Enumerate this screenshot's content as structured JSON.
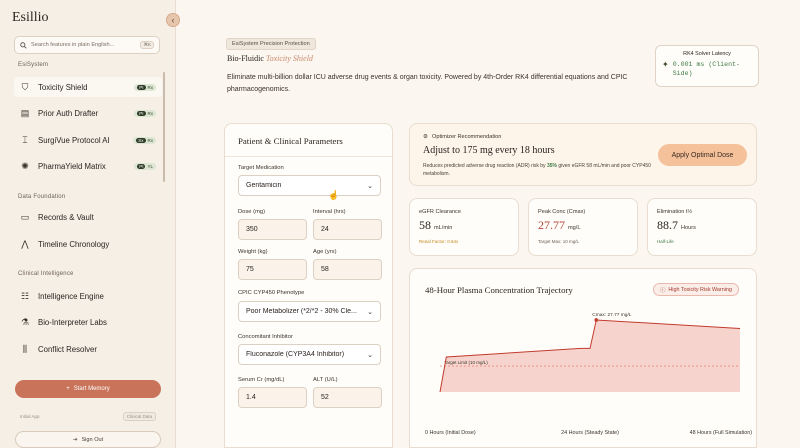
{
  "sidebar": {
    "brand": "Esillio",
    "search_placeholder": "Search features in plain English...",
    "search_shortcut": "⌘K",
    "sections": [
      {
        "label": "EsiSystem"
      },
      {
        "label": "Data Foundation"
      },
      {
        "label": "Clinical Intelligence"
      }
    ],
    "items": [
      {
        "label": "Toxicity Shield",
        "icon": "shield-icon",
        "badge_a": "PI",
        "badge_b": "Rx"
      },
      {
        "label": "Prior Auth Drafter",
        "icon": "document-icon",
        "badge_a": "PI",
        "badge_b": "Rx"
      },
      {
        "label": "SurgiVue Protocol AI",
        "icon": "scalpel-icon",
        "badge_a": "Sx",
        "badge_b": "Rx"
      },
      {
        "label": "PharmaYield Matrix",
        "icon": "gear-icon",
        "badge_a": "PI",
        "badge_b": "YL"
      },
      {
        "label": "Records & Vault",
        "icon": "folder-icon"
      },
      {
        "label": "Timeline Chronology",
        "icon": "timeline-icon"
      },
      {
        "label": "Intelligence Engine",
        "icon": "engine-icon"
      },
      {
        "label": "Bio-Interpreter Labs",
        "icon": "lab-icon"
      },
      {
        "label": "Conflict Resolver",
        "icon": "resolver-icon"
      }
    ],
    "start_memory": "Start Memory",
    "memory_left": "Initial App",
    "memory_tag_a": "Clinical",
    "memory_tag_b": "Data",
    "sign_out": "Sign Out"
  },
  "header": {
    "tag": "EsiSystem Precision Protection",
    "product_a": "Bio-Fluidic",
    "product_b": "Toxicity Shield",
    "description": "Eliminate multi-billion dollar ICU adverse drug events & organ toxicity. Powered by 4th-Order RK4 differential equations and CPIC pharmacogenomics.",
    "latency_title": "RK4 Solver Latency",
    "latency_value": "0.001 ms (Client-Side)"
  },
  "params": {
    "title": "Patient & Clinical Parameters",
    "target_medication_label": "Target Medication",
    "target_medication": "Gentamicin",
    "dose_label": "Dose (mg)",
    "dose": "350",
    "interval_label": "Interval (hrs)",
    "interval": "24",
    "weight_label": "Weight (kg)",
    "weight": "75",
    "age_label": "Age (yrs)",
    "age": "58",
    "phenotype_label": "CPIC CYP450 Phenotype",
    "phenotype": "Poor Metabolizer (*2/*2 - 30% Cle...",
    "inhibitor_label": "Concomitant Inhibitor",
    "inhibitor": "Fluconazole (CYP3A4 Inhibitor)",
    "serum_label": "Serum Cr (mg/dL)",
    "serum": "1.4",
    "alt_label": "ALT (U/L)",
    "alt": "52"
  },
  "optimizer": {
    "head": "Optimizer Recommendation",
    "title": "Adjust to 175 mg every 18 hours",
    "desc_a": "Reduces predicted adverse drug reaction (ADR) risk by",
    "desc_pct": "35%",
    "desc_b": "given eGFR 58 mL/min and poor CYP450 metabolism.",
    "apply": "Apply Optimal Dose"
  },
  "metrics": [
    {
      "label": "eGFR Clearance",
      "value": "58",
      "unit": "mL/min",
      "sub": "Renal Factor: 0.64x"
    },
    {
      "label": "Peak Conc (Cmax)",
      "value": "27.77",
      "unit": "mg/L",
      "sub": "Target Max: 10 mg/L"
    },
    {
      "label": "Elimination t½",
      "value": "88.7",
      "unit": "Hours",
      "sub": "Half-Life"
    }
  ],
  "chart": {
    "title": "48-Hour Plasma Concentration Trajectory",
    "badge": "High Toxicity Risk Warning",
    "cmax_label": "Cmax: 27.77 mg/L",
    "target_label": "Target Limit (10 mg/L)",
    "x_labels": [
      "0 Hours (Initial Dose)",
      "24 Hours (Steady State)",
      "48 Hours (Full Simulation)"
    ]
  },
  "chart_data": {
    "type": "area",
    "title": "48-Hour Plasma Concentration Trajectory",
    "x": [
      0,
      1,
      22.5,
      24,
      25,
      48
    ],
    "y": [
      0,
      13.5,
      16.8,
      16.8,
      27.77,
      24.5
    ],
    "target": 10,
    "ylim": [
      0,
      32
    ],
    "xlim": [
      0,
      48
    ],
    "colors": {
      "line": "#c23b2d",
      "fill": "#f3c6bd",
      "target": "#e06a5b"
    }
  }
}
